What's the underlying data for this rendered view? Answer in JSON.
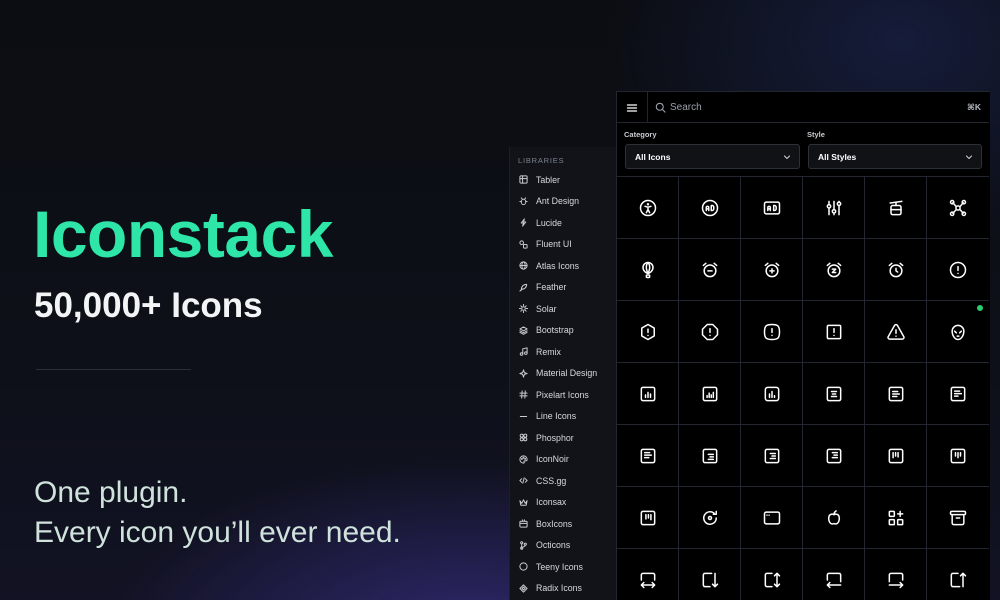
{
  "hero": {
    "title": "Iconstack",
    "subtitle": "50,000+ Icons",
    "tagline_line1": "One plugin.",
    "tagline_line2": "Every icon you’ll ever need.",
    "accent_color": "#2ee6a8"
  },
  "sidebar": {
    "heading": "LIBRARIES",
    "items": [
      {
        "label": "Tabler",
        "icon": "table-icon"
      },
      {
        "label": "Ant Design",
        "icon": "bug-icon"
      },
      {
        "label": "Lucide",
        "icon": "bolt-icon"
      },
      {
        "label": "Fluent UI",
        "icon": "shapes-icon"
      },
      {
        "label": "Atlas Icons",
        "icon": "globe-icon"
      },
      {
        "label": "Feather",
        "icon": "feather-icon"
      },
      {
        "label": "Solar",
        "icon": "sun-icon"
      },
      {
        "label": "Bootstrap",
        "icon": "layers-icon"
      },
      {
        "label": "Remix",
        "icon": "music-icon"
      },
      {
        "label": "Material Design",
        "icon": "sparkle-icon"
      },
      {
        "label": "Pixelart Icons",
        "icon": "hash-icon"
      },
      {
        "label": "Line Icons",
        "icon": "line-icon"
      },
      {
        "label": "Phosphor",
        "icon": "grid-circles-icon"
      },
      {
        "label": "IconNoir",
        "icon": "palette-icon"
      },
      {
        "label": "CSS.gg",
        "icon": "code-icon"
      },
      {
        "label": "Iconsax",
        "icon": "crown-icon"
      },
      {
        "label": "BoxIcons",
        "icon": "box-icon"
      },
      {
        "label": "Octicons",
        "icon": "branch-icon"
      },
      {
        "label": "Teeny Icons",
        "icon": "circle-icon"
      },
      {
        "label": "Radix Icons",
        "icon": "diamond-icon"
      }
    ]
  },
  "panel": {
    "search_placeholder": "Search",
    "shortcut": "⌘K",
    "category_label": "Category",
    "category_value": "All Icons",
    "style_label": "Style",
    "style_value": "All Styles",
    "icons": [
      "accessible-icon",
      "ad-circle-icon",
      "ad-square-icon",
      "adjustments-icon",
      "cable-car-icon",
      "affiliate-icon",
      "air-balloon-icon",
      "alarm-minus-icon",
      "alarm-plus-icon",
      "alarm-snooze-icon",
      "alarm-icon",
      "alert-circle-icon",
      "alert-hexagon-icon",
      "alert-octagon-icon",
      "alert-square-rounded-icon",
      "alert-square-icon",
      "alert-triangle-icon",
      "alien-icon",
      "chart-square-icon",
      "chart-bar-square-icon",
      "chart-bar-rounded-icon",
      "align-box-center-icon",
      "align-box-left-icon",
      "align-box-left-alt-icon",
      "align-box-left-top-icon",
      "align-box-right-icon",
      "align-box-right-middle-icon",
      "align-box-right-top-icon",
      "align-box-top-left-icon",
      "align-box-top-center-icon",
      "align-box-top-right-icon",
      "rotate-dot-icon",
      "window-icon",
      "apple-icon",
      "apps-icon",
      "archive-icon",
      "arrow-autofit-width-icon",
      "arrow-autofit-down-icon",
      "arrow-autofit-height-icon",
      "arrow-autofit-left-icon",
      "arrow-autofit-right-icon",
      "arrow-autofit-up-icon"
    ]
  }
}
